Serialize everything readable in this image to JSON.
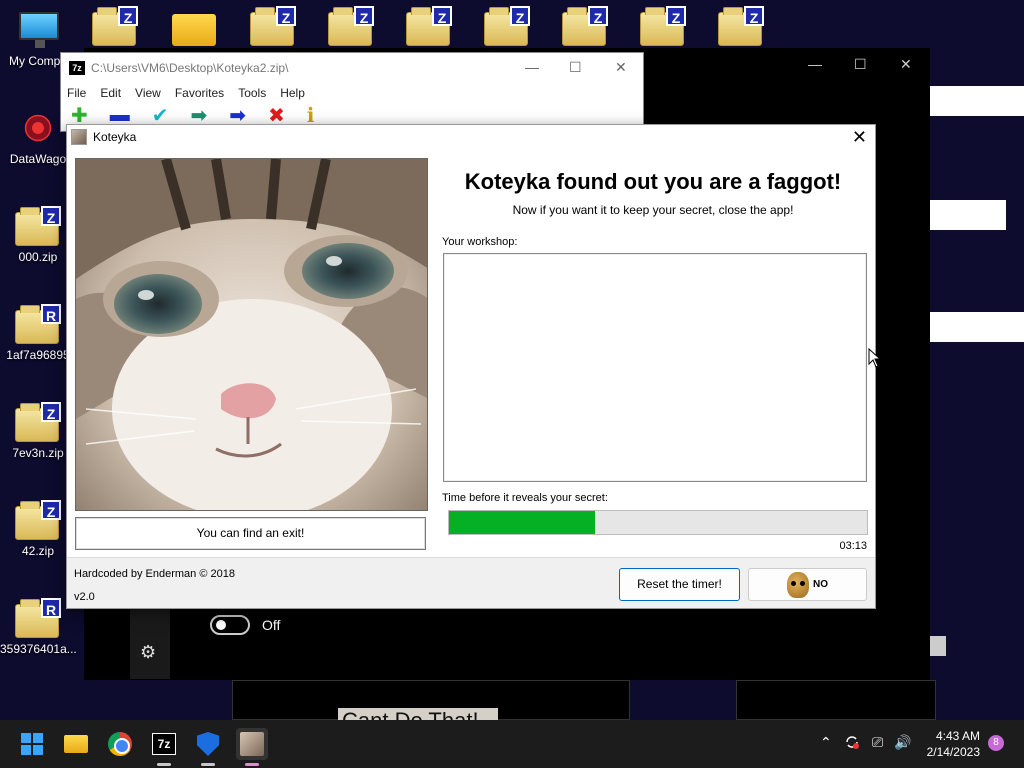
{
  "desktop": {
    "icons": [
      {
        "label": "My Compu",
        "type": "monitor"
      },
      {
        "label": "DataWago",
        "type": "web"
      },
      {
        "label": "000.zip",
        "badge": "Z"
      },
      {
        "label": "1af7a96895",
        "badge": "R"
      },
      {
        "label": "7ev3n.zip",
        "badge": "Z"
      },
      {
        "label": "42.zip",
        "badge": "Z"
      },
      {
        "label": "359376401a...",
        "badge": "R"
      }
    ],
    "top_badges": [
      "Z",
      "Z",
      "Z",
      "Z",
      "Z",
      "Z",
      "Z",
      "Z"
    ]
  },
  "sevenzip": {
    "logo": "7z",
    "title": "C:\\Users\\VM6\\Desktop\\Koteyka2.zip\\",
    "menu": [
      "File",
      "Edit",
      "View",
      "Favorites",
      "Tools",
      "Help"
    ],
    "toolbar_glyphs": [
      "✚",
      "▬",
      "✔",
      "➡",
      "➡",
      "✖",
      "ℹ"
    ],
    "caption_min": "—",
    "caption_max": "☐",
    "caption_close": "✕"
  },
  "bg_window": {
    "caption_min": "—",
    "caption_max": "☐",
    "caption_close": "✕"
  },
  "koteyka": {
    "title": "Koteyka",
    "close": "✕",
    "headline": "Koteyka found out you are a faggot!",
    "subline": "Now if you want it to keep your secret, close the app!",
    "workshop_label": "Your workshop:",
    "workshop_value": "",
    "time_label": "Time before it reveals your secret:",
    "progress": 0.35,
    "timer": "03:13",
    "exit_button": "You can find an exit!",
    "credit": "Hardcoded by Enderman © 2018",
    "version": "v2.0",
    "reset_button": "Reset the timer!",
    "image_button_text": "NO"
  },
  "settings": {
    "toggle_label": "Off",
    "gear": "⚙"
  },
  "cantdo": "Cant Do That!",
  "taskbar": {
    "tray": {
      "chevron": "⌃",
      "net": "⎚",
      "vol": "🔊"
    },
    "time": "4:43 AM",
    "date": "2/14/2023",
    "notifications": "8"
  },
  "colors": {
    "progress_fill": "#06b025",
    "reset_border": "#0067c0",
    "desktop_bg": "#0d0b2e"
  }
}
